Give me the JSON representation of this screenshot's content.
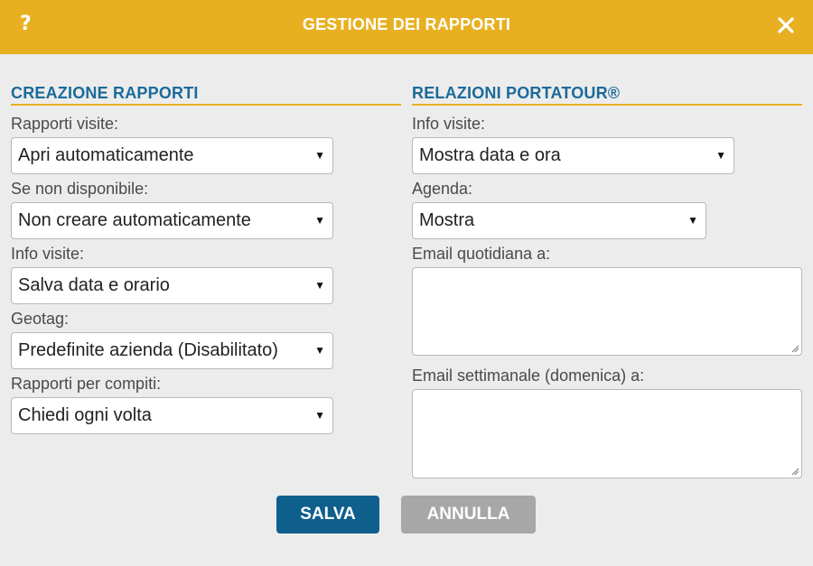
{
  "header": {
    "help_label": "?",
    "title": "GESTIONE DEI RAPPORTI",
    "accent_color": "#e8b021"
  },
  "left": {
    "section_title": "CREAZIONE RAPPORTI",
    "fields": [
      {
        "label": "Rapporti visite:",
        "value": "Apri automaticamente"
      },
      {
        "label": "Se non disponibile:",
        "value": "Non creare automaticamente"
      },
      {
        "label": "Info visite:",
        "value": "Salva data e orario"
      },
      {
        "label": "Geotag:",
        "value": "Predefinite azienda (Disabilitato)"
      },
      {
        "label": "Rapporti per compiti:",
        "value": "Chiedi ogni volta"
      }
    ]
  },
  "right": {
    "section_title": "RELAZIONI PORTATOUR®",
    "fields": [
      {
        "label": "Info visite:",
        "value": "Mostra data e ora"
      },
      {
        "label": "Agenda:",
        "value": "Mostra"
      }
    ],
    "daily_email_label": "Email quotidiana a:",
    "daily_email_value": "",
    "weekly_email_label": "Email settimanale (domenica) a:",
    "weekly_email_value": ""
  },
  "buttons": {
    "save_label": "SALVA",
    "cancel_label": "ANNULLA"
  },
  "icons": {
    "close": "close-icon",
    "dropdown": "caret-down-icon",
    "resize": "resize-grip-icon"
  }
}
